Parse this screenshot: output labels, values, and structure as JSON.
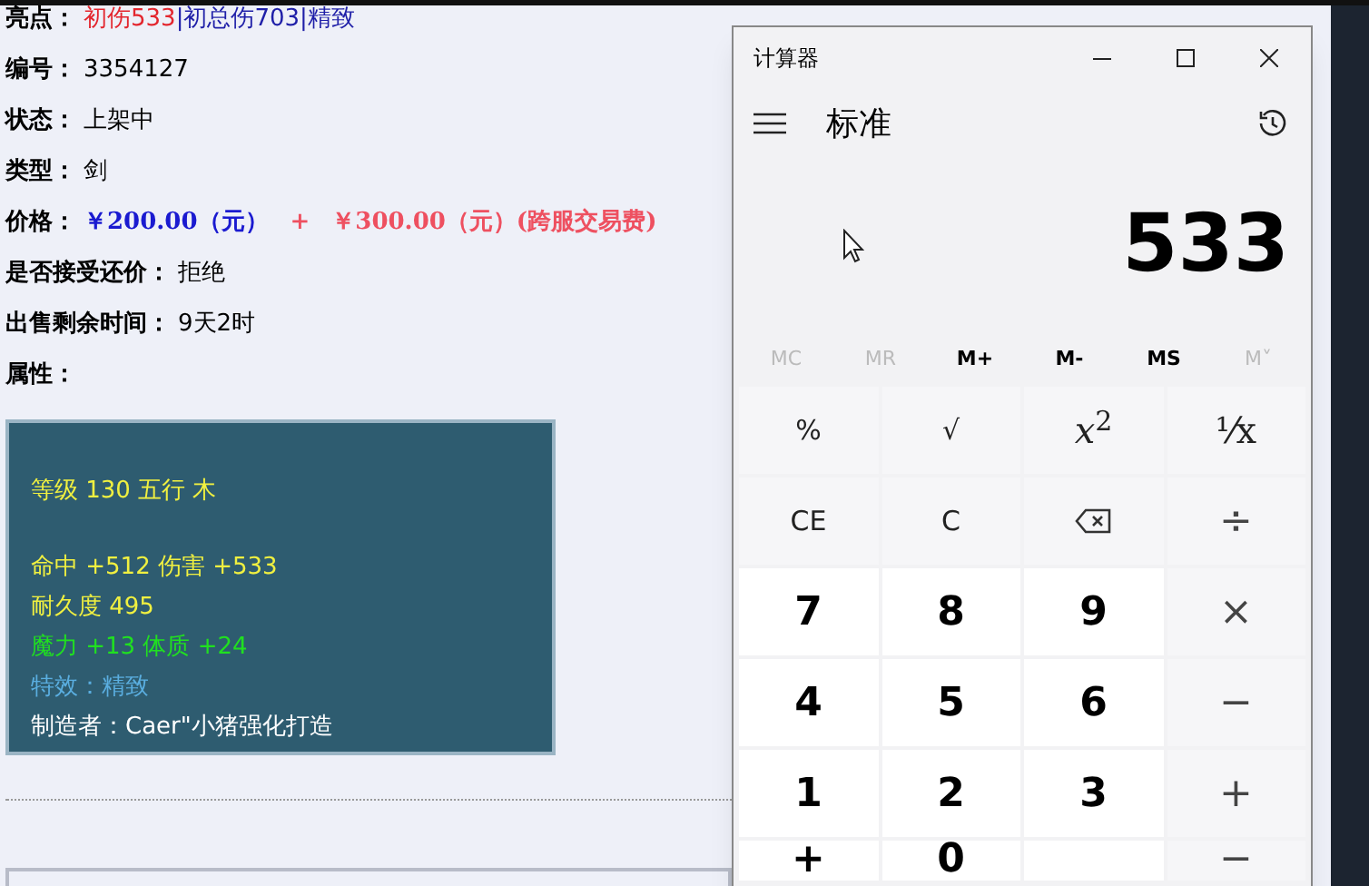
{
  "listing": {
    "fields": [
      {
        "kind": "highlight",
        "label": "亮点：",
        "segments": [
          {
            "text": "初伤533",
            "color": "#e3262e"
          },
          {
            "text": "|初总伤703|精致",
            "color": "#1f1fa8"
          }
        ]
      },
      {
        "kind": "text",
        "label": "编号：",
        "value": "3354127"
      },
      {
        "kind": "text",
        "label": "状态：",
        "value": "上架中"
      },
      {
        "kind": "text",
        "label": "类型：",
        "value": "剑"
      },
      {
        "kind": "price",
        "label": "价格：",
        "segments": [
          {
            "text": "￥200.00（元）",
            "color": "#1a1ad0"
          },
          {
            "text": "+",
            "color": "#ee5060"
          },
          {
            "text": "￥300.00（元）(跨服交易费)",
            "color": "#ee5060"
          }
        ]
      },
      {
        "kind": "text",
        "label": "是否接受还价：",
        "value": "拒绝"
      },
      {
        "kind": "text",
        "label": "出售剩余时间：",
        "value": "9天2时"
      },
      {
        "kind": "text",
        "label": "属性："
      }
    ],
    "attributes": {
      "blocks": [
        [
          {
            "text": "等级 130 五行 木",
            "color": "#f0f040"
          }
        ],
        [
          {
            "text": "命中 +512 伤害 +533",
            "color": "#f0f040"
          },
          {
            "text": "耐久度 495",
            "color": "#f0f040"
          },
          {
            "text": "魔力 +13 体质 +24",
            "color": "#20e020"
          },
          {
            "text": "特效：精致",
            "color": "#5aaee0"
          },
          {
            "text": "制造者：Caer\"小猪强化打造",
            "color": "#ffffff"
          }
        ]
      ]
    }
  },
  "calculator": {
    "title": "计算器",
    "mode": "标准",
    "display": "533",
    "memory": [
      {
        "label": "MC",
        "disabled": true
      },
      {
        "label": "MR",
        "disabled": true
      },
      {
        "label": "M+",
        "disabled": false
      },
      {
        "label": "M-",
        "disabled": false
      },
      {
        "label": "MS",
        "disabled": false
      },
      {
        "label": "M˅",
        "disabled": true
      }
    ],
    "keys": [
      {
        "kind": "function",
        "label": "%"
      },
      {
        "kind": "function",
        "label": "√"
      },
      {
        "kind": "function",
        "label": "*x*$^{2}$"
      },
      {
        "kind": "function",
        "label": "⅟x"
      },
      {
        "kind": "function",
        "label": "CE"
      },
      {
        "kind": "function",
        "label": "C"
      },
      {
        "kind": "backspace"
      },
      {
        "kind": "operator",
        "label": "÷"
      },
      {
        "kind": "digit",
        "label": "7"
      },
      {
        "kind": "digit",
        "label": "8"
      },
      {
        "kind": "digit",
        "label": "9"
      },
      {
        "kind": "operator",
        "label": "×"
      },
      {
        "kind": "digit",
        "label": "4"
      },
      {
        "kind": "digit",
        "label": "5"
      },
      {
        "kind": "digit",
        "label": "6"
      },
      {
        "kind": "operator",
        "label": "−"
      },
      {
        "kind": "digit",
        "label": "1"
      },
      {
        "kind": "digit",
        "label": "2"
      },
      {
        "kind": "digit",
        "label": "3"
      },
      {
        "kind": "operator",
        "label": "+"
      }
    ],
    "cut_keys": [
      {
        "kind": "digit",
        "label": "+"
      },
      {
        "kind": "digit",
        "label": "0"
      },
      {
        "kind": "digit"
      },
      {
        "kind": "operator",
        "label": "−"
      }
    ]
  }
}
